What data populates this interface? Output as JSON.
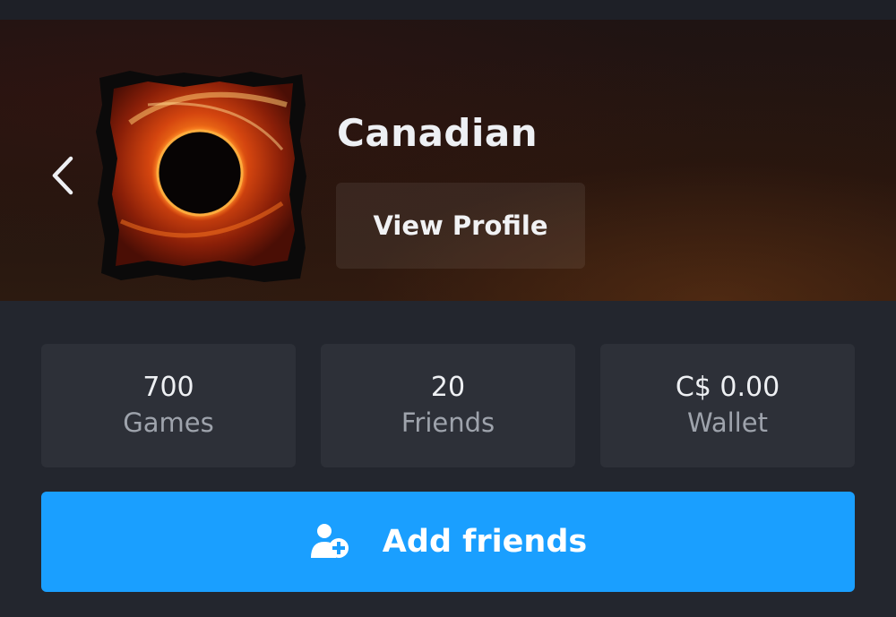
{
  "profile": {
    "username": "Canadian",
    "view_profile_label": "View Profile"
  },
  "stats": [
    {
      "value": "700",
      "label": "Games"
    },
    {
      "value": "20",
      "label": "Friends"
    },
    {
      "value": "C$ 0.00",
      "label": "Wallet"
    }
  ],
  "actions": {
    "add_friends_label": "Add friends"
  },
  "icons": {
    "back": "chevron-left-icon",
    "add_friend": "add-person-icon"
  },
  "colors": {
    "background": "#23262e",
    "card": "#2d3038",
    "accent": "#1a9fff"
  }
}
